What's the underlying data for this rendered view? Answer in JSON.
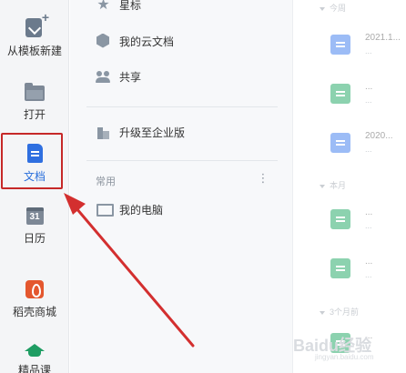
{
  "rail": {
    "items": [
      {
        "label": "从模板新建",
        "icon": "new-from-template-icon"
      },
      {
        "label": "打开",
        "icon": "folder-icon"
      },
      {
        "label": "文档",
        "icon": "document-icon"
      },
      {
        "label": "日历",
        "icon": "calendar-icon",
        "icon_text": "31"
      },
      {
        "label": "稻壳商城",
        "icon": "store-icon"
      },
      {
        "label": "精品课",
        "icon": "course-icon"
      }
    ],
    "selected_color": "#2a6fdb",
    "highlight_color": "#c62828"
  },
  "nav": {
    "star": "星标",
    "cloud_docs": "我的云文档",
    "shared": "共享",
    "upgrade": "升级至企业版",
    "section_common": "常用",
    "more": "⋮",
    "my_pc": "我的电脑"
  },
  "filelist": {
    "groups": [
      "今周",
      "本月",
      "3个月前"
    ],
    "files": [
      {
        "name": "2021.1...",
        "meta": "...",
        "color": "#4c86f0"
      },
      {
        "name": "...",
        "meta": "...",
        "color": "#2fae6e"
      },
      {
        "name": "2020...",
        "meta": "...",
        "color": "#4c86f0"
      },
      {
        "name": "...",
        "meta": "...",
        "color": "#2fae6e"
      },
      {
        "name": "...",
        "meta": "...",
        "color": "#2fae6e"
      },
      {
        "name": "...",
        "meta": "...",
        "color": "#2fae6e"
      }
    ]
  },
  "annotation": {
    "arrow_color": "#d32f2f"
  },
  "watermark": {
    "text": "Baidu经验",
    "sub": "jingyan.baidu.com"
  }
}
